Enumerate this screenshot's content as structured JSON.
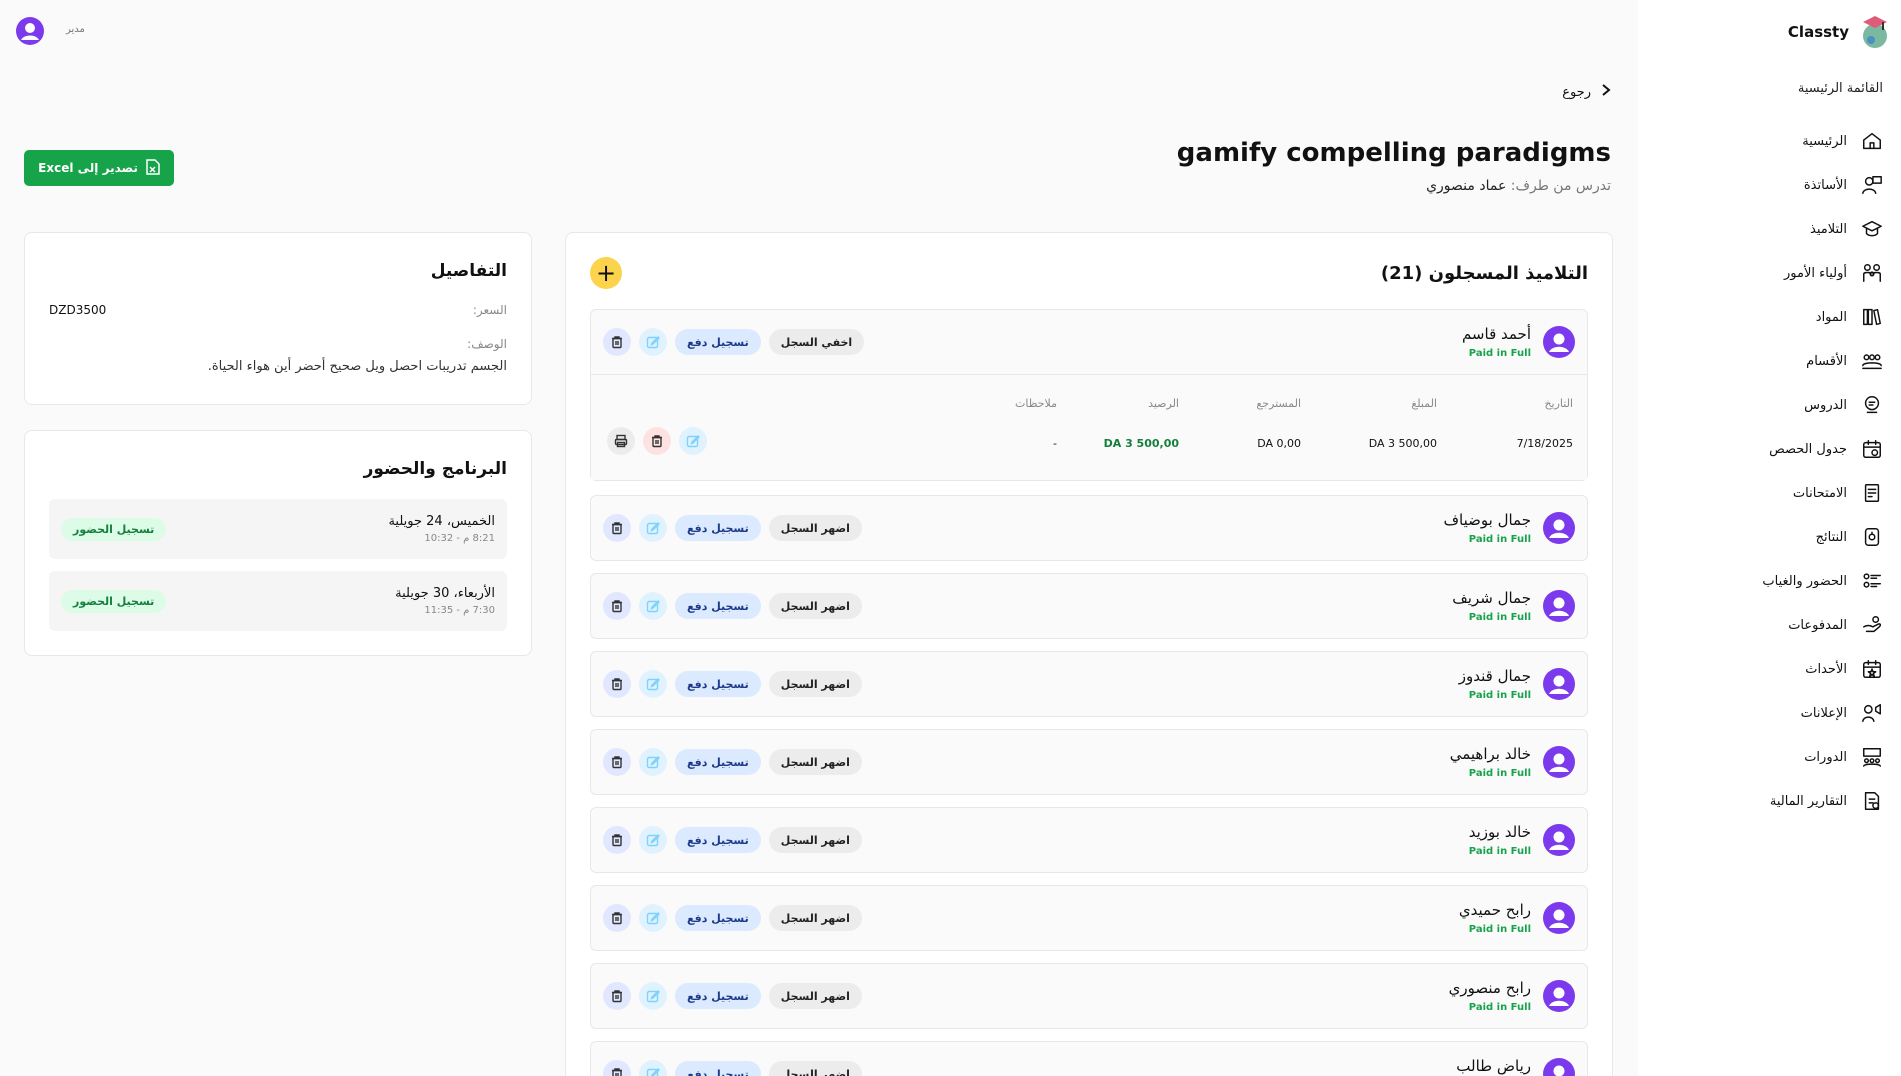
{
  "topbar": {
    "role": "مدير"
  },
  "sidebar": {
    "brand": "Classty",
    "menu_title": "القائمة الرئيسية",
    "items": [
      {
        "label": "الرئيسية",
        "icon": "home-icon"
      },
      {
        "label": "الأساتذة",
        "icon": "teacher-icon"
      },
      {
        "label": "التلاميذ",
        "icon": "graduation-cap-icon"
      },
      {
        "label": "أولياء الأمور",
        "icon": "parents-icon"
      },
      {
        "label": "المواد",
        "icon": "books-icon"
      },
      {
        "label": "الأقسام",
        "icon": "classes-icon"
      },
      {
        "label": "الدروس",
        "icon": "lessons-icon"
      },
      {
        "label": "جدول الحصص",
        "icon": "calendar-clock-icon"
      },
      {
        "label": "الامتحانات",
        "icon": "exam-icon"
      },
      {
        "label": "النتائج",
        "icon": "results-icon"
      },
      {
        "label": "الحضور والغياب",
        "icon": "attendance-icon"
      },
      {
        "label": "المدفوعات",
        "icon": "payments-icon"
      },
      {
        "label": "الأحداث",
        "icon": "event-icon"
      },
      {
        "label": "الإعلانات",
        "icon": "announcement-icon"
      },
      {
        "label": "الدورات",
        "icon": "courses-icon"
      },
      {
        "label": "التقارير المالية",
        "icon": "financial-report-icon"
      }
    ]
  },
  "header": {
    "back": "رجوع",
    "title": "gamify compelling paradigms",
    "teacher_prefix": "تدرس من طرف:",
    "teacher_name": "عماد منصوري",
    "export": "تصدير إلى Excel"
  },
  "details": {
    "title": "التفاصيل",
    "price_label": "السعر:",
    "price_value": "DZD3500",
    "desc_label": "الوصف:",
    "desc_text": "الجسم تدريبات احصل ويل صحيح أحضر أين هواء الحياة."
  },
  "schedule": {
    "title": "البرنامج والحضور",
    "sessions": [
      {
        "date": "الخميس، 24 جويلية",
        "time": "8:21 م - 10:32",
        "button": "تسجيل الحضور"
      },
      {
        "date": "الأربعاء، 30 جويلية",
        "time": "7:30 م - 11:35",
        "button": "تسجيل الحضور"
      }
    ]
  },
  "students": {
    "title": "التلاميذ المسجلون (21)",
    "status_text": "Paid in Full",
    "show_label": "اضهر السجل",
    "hide_label": "اخفي السجل",
    "pay_label": "تسجيل دفع",
    "list": [
      {
        "name": "أحمد قاسم",
        "expanded": true
      },
      {
        "name": "جمال بوضياف"
      },
      {
        "name": "جمال شريف"
      },
      {
        "name": "جمال قندوز"
      },
      {
        "name": "خالد براهيمي"
      },
      {
        "name": "خالد بوزيد"
      },
      {
        "name": "رابح حميدي"
      },
      {
        "name": "رابح منصوري"
      },
      {
        "name": "رياض طالب"
      }
    ],
    "record": {
      "headers": {
        "date": "التاريخ",
        "amount": "المبلغ",
        "refund": "المسترجع",
        "balance": "الرصيد",
        "notes": "ملاحظات"
      },
      "row": {
        "date": "7/18/2025",
        "amount": "DA 3 500,00",
        "refund": "DA 0,00",
        "balance": "DA 3 500,00",
        "notes": "-"
      }
    }
  },
  "colors": {
    "accent": "#16a34a",
    "avatar": "#7c3aed",
    "add": "#fcd34d"
  }
}
